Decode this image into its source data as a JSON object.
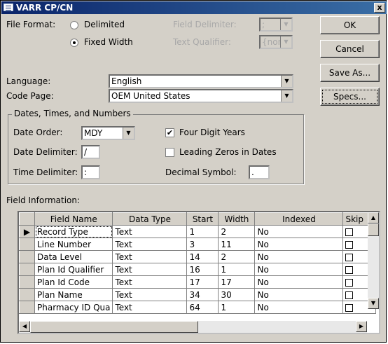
{
  "window": {
    "title": "VARR CP/CN",
    "close_label": "x"
  },
  "file_format": {
    "label": "File Format:",
    "delimited_label": "Delimited",
    "fixed_label": "Fixed Width",
    "selected": "Fixed Width",
    "field_delimiter_label": "Field Delimiter:",
    "field_delimiter_value": ";",
    "text_qualifier_label": "Text Qualifier:",
    "text_qualifier_value": "{none}"
  },
  "language": {
    "label": "Language:",
    "value": "English"
  },
  "code_page": {
    "label": "Code Page:",
    "value": "OEM United States"
  },
  "dates_group": {
    "title": "Dates, Times, and Numbers",
    "date_order_label": "Date Order:",
    "date_order_value": "MDY",
    "date_delimiter_label": "Date Delimiter:",
    "date_delimiter_value": "/",
    "time_delimiter_label": "Time Delimiter:",
    "time_delimiter_value": ":",
    "four_digit_years_label": "Four Digit Years",
    "four_digit_years_checked": true,
    "leading_zeros_label": "Leading Zeros in Dates",
    "leading_zeros_checked": false,
    "decimal_symbol_label": "Decimal Symbol:",
    "decimal_symbol_value": "."
  },
  "buttons": {
    "ok": "OK",
    "cancel": "Cancel",
    "save_as": "Save As...",
    "specs": "Specs..."
  },
  "field_information": {
    "label": "Field Information:",
    "columns": [
      "Field Name",
      "Data Type",
      "Start",
      "Width",
      "Indexed",
      "Skip"
    ],
    "rows": [
      {
        "field_name": "Record Type",
        "data_type": "Text",
        "start": "1",
        "width": "2",
        "indexed": "No"
      },
      {
        "field_name": "Line Number",
        "data_type": "Text",
        "start": "3",
        "width": "11",
        "indexed": "No"
      },
      {
        "field_name": "Data Level",
        "data_type": "Text",
        "start": "14",
        "width": "2",
        "indexed": "No"
      },
      {
        "field_name": "Plan Id Qualifier",
        "data_type": "Text",
        "start": "16",
        "width": "1",
        "indexed": "No"
      },
      {
        "field_name": "Plan Id Code",
        "data_type": "Text",
        "start": "17",
        "width": "17",
        "indexed": "No"
      },
      {
        "field_name": "Plan Name",
        "data_type": "Text",
        "start": "34",
        "width": "30",
        "indexed": "No"
      },
      {
        "field_name": "Pharmacy ID Qua",
        "data_type": "Text",
        "start": "64",
        "width": "1",
        "indexed": "No"
      }
    ]
  }
}
